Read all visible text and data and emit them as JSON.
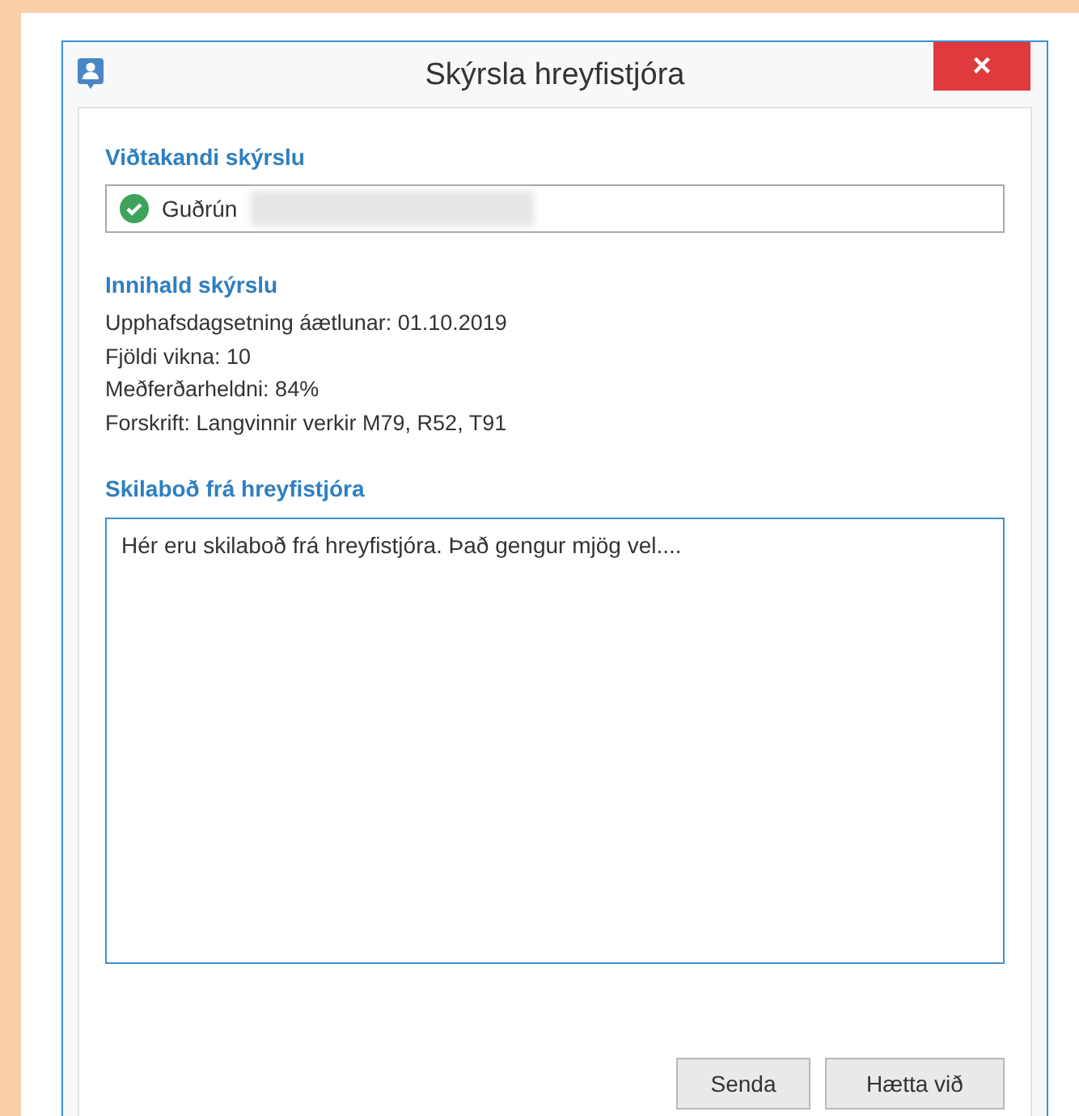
{
  "window": {
    "title": "Skýrsla hreyfistjóra",
    "close": "×"
  },
  "recipient": {
    "heading": "Viðtakandi skýrslu",
    "name": "Guðrún",
    "verified": true,
    "redacted": true
  },
  "content": {
    "heading": "Innihald skýrslu",
    "lines": [
      "Upphafsdagsetning áætlunar: 01.10.2019",
      "Fjöldi vikna: 10",
      "Meðferðarheldni: 84%",
      "Forskrift: Langvinnir verkir M79, R52, T91"
    ]
  },
  "message": {
    "heading": "Skilaboð frá hreyfistjóra",
    "value": "Hér eru skilaboð frá hreyfistjóra. Það gengur mjög vel...."
  },
  "buttons": [
    "Senda",
    "Hætta við"
  ]
}
